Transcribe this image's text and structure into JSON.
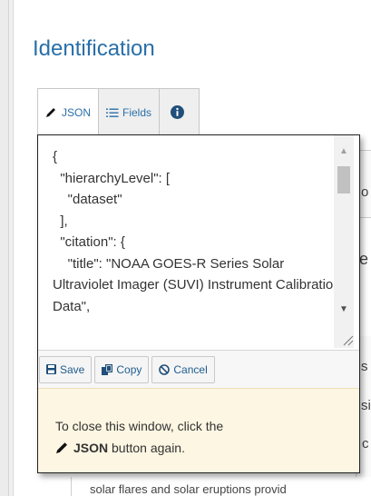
{
  "panel": {
    "title": "Identification"
  },
  "tabs": [
    {
      "label": "JSON",
      "icon": "pencil-icon"
    },
    {
      "label": "Fields",
      "icon": "list-icon"
    },
    {
      "label": "",
      "icon": "info-icon"
    }
  ],
  "editor": {
    "content": "{\n  \"hierarchyLevel\": [\n    \"dataset\"\n  ],\n  \"citation\": {\n    \"title\": \"NOAA GOES-R Series Solar Ultraviolet Imager (SUVI) Instrument Calibration Data\","
  },
  "buttons": {
    "save": "Save",
    "copy": "Copy",
    "cancel": "Cancel"
  },
  "help": {
    "text_prefix": "To close this window, click the",
    "button_name": "JSON",
    "text_suffix": "button again."
  },
  "background": {
    "fragment_1": "o",
    "fragment_2": "e",
    "fragment_3": "s",
    "fragment_4": "si",
    "fragment_5": "c",
    "bottom_line": "solar flares and solar eruptions provid"
  },
  "colors": {
    "title": "#2a6fa8",
    "link": "#1f5d8f",
    "help_bg": "#fcf6e2"
  }
}
